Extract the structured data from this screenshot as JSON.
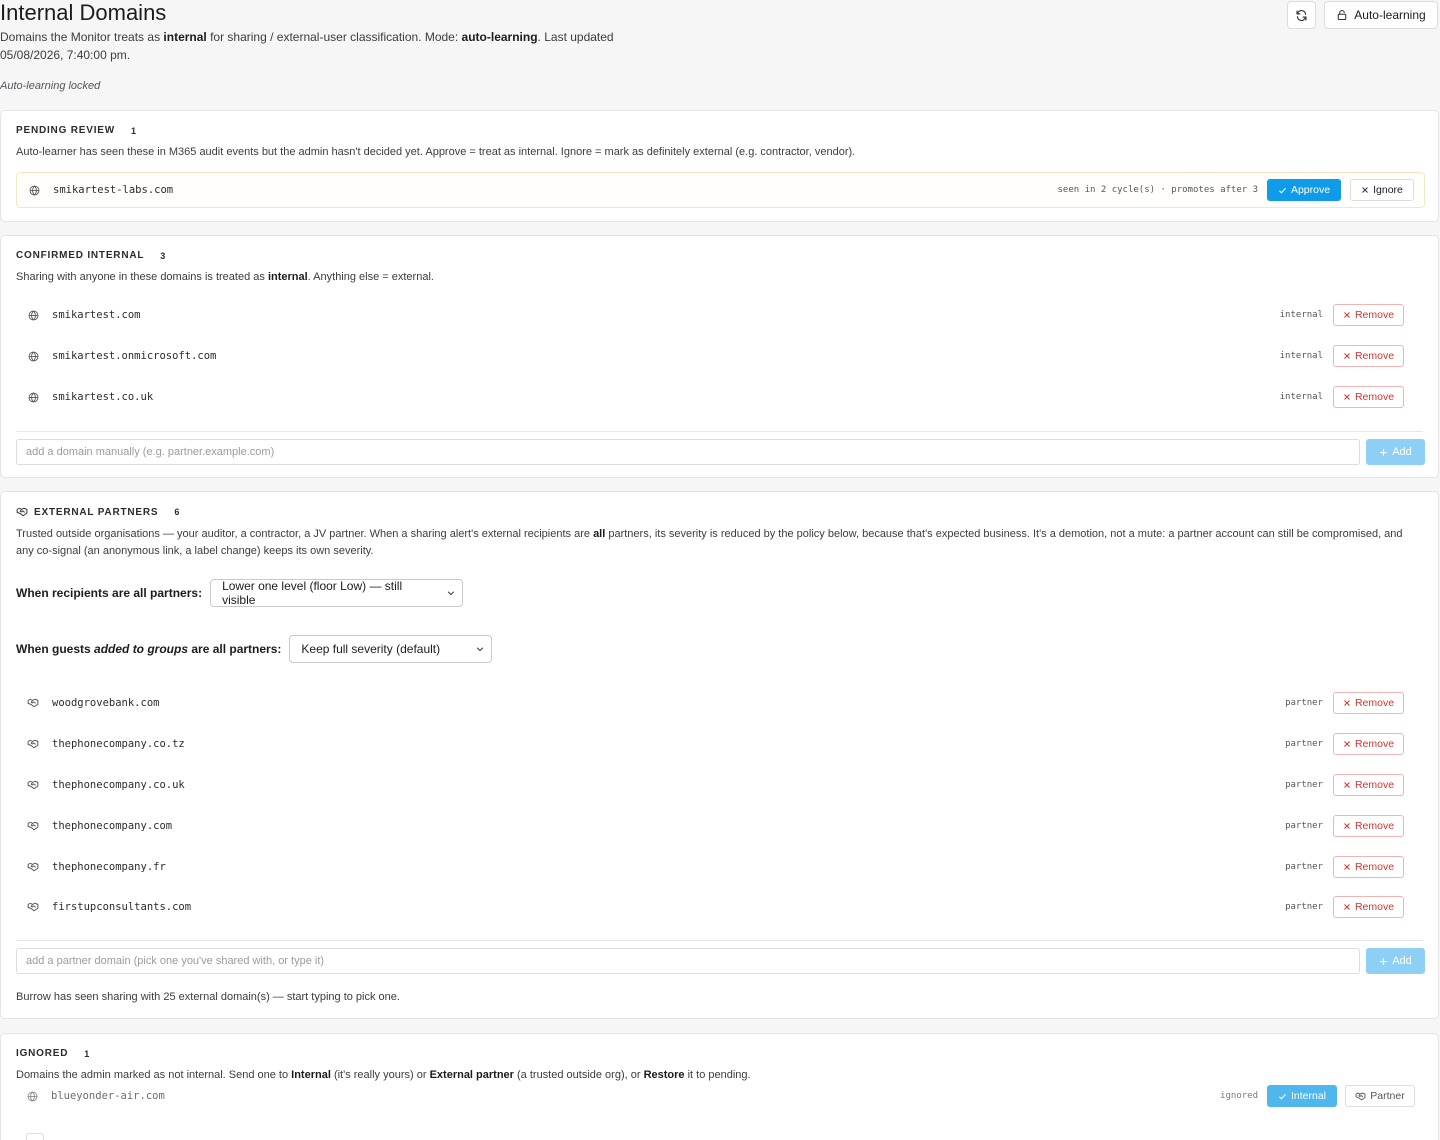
{
  "header": {
    "title": "Internal Domains",
    "sub_pre": "Domains the Monitor treats as ",
    "sub_b1": "internal",
    "sub_mid": " for sharing / external-user classification. Mode: ",
    "sub_b2": "auto-learning",
    "sub_post": ". Last updated 05/08/2026, 7:40:00 pm.",
    "locked_note": "Auto-learning locked",
    "auto_button": "Auto-learning"
  },
  "pending": {
    "title": "PENDING REVIEW",
    "count": "1",
    "desc": "Auto-learner has seen these in M365 audit events but the admin hasn't decided yet. Approve = treat as internal. Ignore = mark as definitely external (e.g. contractor, vendor).",
    "items": [
      {
        "domain": "smikartest-labs.com",
        "seen": "seen in 2 cycle(s) · promotes after 3"
      }
    ],
    "approve_label": "Approve",
    "ignore_label": "Ignore"
  },
  "confirmed": {
    "title": "CONFIRMED INTERNAL",
    "count": "3",
    "desc_pre": "Sharing with anyone in these domains is treated as ",
    "desc_b": "internal",
    "desc_post": ". Anything else = external.",
    "items": [
      {
        "domain": "smikartest.com",
        "tag": "internal"
      },
      {
        "domain": "smikartest.onmicrosoft.com",
        "tag": "internal"
      },
      {
        "domain": "smikartest.co.uk",
        "tag": "internal"
      }
    ],
    "remove_label": "Remove",
    "input_placeholder": "add a domain manually (e.g. partner.example.com)",
    "add_label": "Add"
  },
  "partners": {
    "title": "EXTERNAL PARTNERS",
    "count": "6",
    "desc_pre": "Trusted outside organisations — your auditor, a contractor, a JV partner. When a sharing alert's external recipients are ",
    "desc_b": "all",
    "desc_post": " partners, its severity is reduced by the policy below, because that's expected business. It's a demotion, not a mute: a partner account can still be compromised, and any co-signal (an anonymous link, a label change) keeps its own severity.",
    "policy1_label": "When recipients are all partners:",
    "policy1_value": "Lower one level (floor Low) — still visible",
    "policy2_pre": "When guests ",
    "policy2_em": "added to groups",
    "policy2_post": " are all partners:",
    "policy2_value": "Keep full severity (default)",
    "items": [
      {
        "domain": "woodgrovebank.com",
        "tag": "partner"
      },
      {
        "domain": "thephonecompany.co.tz",
        "tag": "partner"
      },
      {
        "domain": "thephonecompany.co.uk",
        "tag": "partner"
      },
      {
        "domain": "thephonecompany.com",
        "tag": "partner"
      },
      {
        "domain": "thephonecompany.fr",
        "tag": "partner"
      },
      {
        "domain": "firstupconsultants.com",
        "tag": "partner"
      }
    ],
    "remove_label": "Remove",
    "input_placeholder": "add a partner domain (pick one you've shared with, or type it)",
    "add_label": "Add",
    "footnote": "Burrow has seen sharing with 25 external domain(s) — start typing to pick one."
  },
  "ignored": {
    "title": "IGNORED",
    "count": "1",
    "desc_pre": "Domains the admin marked as not internal. Send one to ",
    "desc_b1": "Internal",
    "desc_m1": " (it's really yours) or ",
    "desc_b2": "External partner",
    "desc_m2": " (a trusted outside org), or ",
    "desc_b3": "Restore",
    "desc_post": " it to pending.",
    "items": [
      {
        "domain": "blueyonder-air.com",
        "tag": "ignored"
      }
    ],
    "internal_label": "Internal",
    "partner_label": "Partner"
  },
  "colors": {
    "accent": "#0f9be8",
    "danger": "#d4332f",
    "pending_border": "#f2e7c4"
  },
  "icons": [
    "refresh-icon",
    "lock-icon",
    "globe-icon",
    "handshake-icon",
    "check-icon",
    "x-icon",
    "plus-icon",
    "chevron-down-icon"
  ]
}
